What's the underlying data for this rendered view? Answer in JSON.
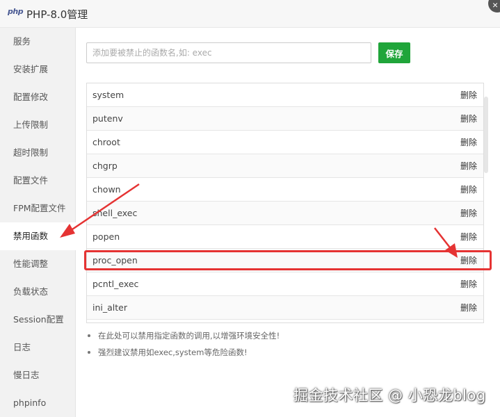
{
  "window": {
    "logo_text": "php",
    "title": "PHP-8.0管理",
    "close_glyph": "×"
  },
  "sidebar": {
    "items": [
      {
        "label": "服务"
      },
      {
        "label": "安装扩展"
      },
      {
        "label": "配置修改"
      },
      {
        "label": "上传限制"
      },
      {
        "label": "超时限制"
      },
      {
        "label": "配置文件"
      },
      {
        "label": "FPM配置文件"
      },
      {
        "label": "禁用函数",
        "active": true
      },
      {
        "label": "性能调整"
      },
      {
        "label": "负载状态"
      },
      {
        "label": "Session配置"
      },
      {
        "label": "日志"
      },
      {
        "label": "慢日志"
      },
      {
        "label": "phpinfo"
      }
    ]
  },
  "form": {
    "input_value": "",
    "input_placeholder": "添加要被禁止的函数名,如: exec",
    "save_label": "保存"
  },
  "table": {
    "delete_label": "删除",
    "rows": [
      {
        "name": "system"
      },
      {
        "name": "putenv"
      },
      {
        "name": "chroot"
      },
      {
        "name": "chgrp"
      },
      {
        "name": "chown"
      },
      {
        "name": "shell_exec"
      },
      {
        "name": "popen"
      },
      {
        "name": "proc_open",
        "highlighted": true
      },
      {
        "name": "pcntl_exec"
      },
      {
        "name": "ini_alter"
      }
    ]
  },
  "tips": [
    "在此处可以禁用指定函数的调用,以增强环境安全性!",
    "强烈建议禁用如exec,system等危险函数!"
  ],
  "watermark": "掘金技术社区 @ 小恐龙blog",
  "annotation_color": "#e53333",
  "accent_color": "#20a53a"
}
